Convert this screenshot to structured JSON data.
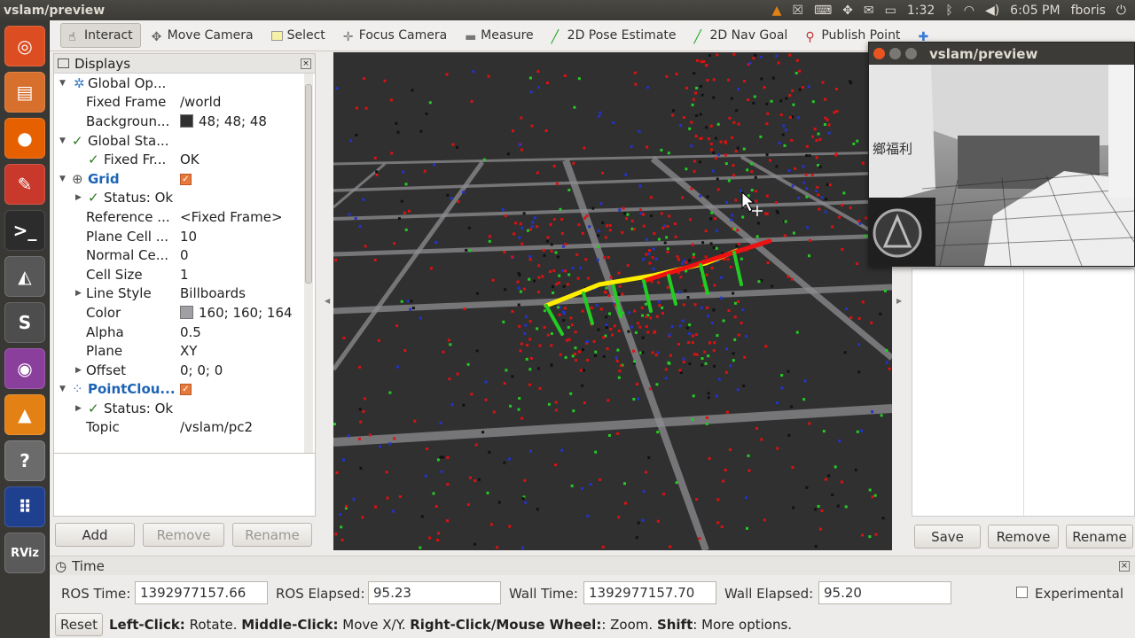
{
  "window": {
    "title": "vslam/preview"
  },
  "system_tray": {
    "time": "1:32",
    "clock": "6:05 PM",
    "user": "fboris"
  },
  "launcher": {
    "items": [
      {
        "name": "ubuntu-dash-icon",
        "color": "#dc4e21",
        "glyph": "◎"
      },
      {
        "name": "files-icon",
        "color": "#d8702d",
        "glyph": "▤"
      },
      {
        "name": "firefox-icon",
        "color": "#e66000",
        "glyph": "●"
      },
      {
        "name": "system-settings-icon",
        "color": "#c8392b",
        "glyph": "✎"
      },
      {
        "name": "terminal-icon",
        "color": "#2c2c2c",
        "glyph": ">_"
      },
      {
        "name": "inkscape-icon",
        "color": "#575757",
        "glyph": "◭"
      },
      {
        "name": "sublime-text-icon",
        "color": "#4d4d4d",
        "glyph": "S"
      },
      {
        "name": "webcam-icon",
        "color": "#8a3f9c",
        "glyph": "◉"
      },
      {
        "name": "vlc-icon",
        "color": "#e38114",
        "glyph": "▲"
      },
      {
        "name": "help-icon",
        "color": "#6b6b6b",
        "glyph": "?"
      },
      {
        "name": "workspace-switcher-icon",
        "color": "#1f3f8f",
        "glyph": "⠿"
      },
      {
        "name": "rviz-icon",
        "color": "#5a5a5a",
        "glyph": "RViz"
      }
    ]
  },
  "toolbar": {
    "interact": "Interact",
    "move_camera": "Move Camera",
    "select": "Select",
    "focus_camera": "Focus Camera",
    "measure": "Measure",
    "pose_estimate": "2D Pose Estimate",
    "nav_goal": "2D Nav Goal",
    "publish_point": "Publish Point"
  },
  "displays": {
    "title": "Displays",
    "rows": [
      {
        "key": "Global Op...",
        "value": ""
      },
      {
        "key": "Fixed Frame",
        "value": "/world"
      },
      {
        "key": "Backgroun...",
        "value": "48; 48; 48"
      },
      {
        "key": "Global Sta...",
        "value": ""
      },
      {
        "key": "Fixed Fr...",
        "value": "OK"
      },
      {
        "key": "Grid",
        "value": ""
      },
      {
        "key": "Status: Ok",
        "value": ""
      },
      {
        "key": "Reference ...",
        "value": "<Fixed Frame>"
      },
      {
        "key": "Plane Cell ...",
        "value": "10"
      },
      {
        "key": "Normal Ce...",
        "value": "0"
      },
      {
        "key": "Cell Size",
        "value": "1"
      },
      {
        "key": "Line Style",
        "value": "Billboards"
      },
      {
        "key": "Color",
        "value": "160; 160; 164"
      },
      {
        "key": "Alpha",
        "value": "0.5"
      },
      {
        "key": "Plane",
        "value": "XY"
      },
      {
        "key": "Offset",
        "value": "0; 0; 0"
      },
      {
        "key": "PointClou...",
        "value": ""
      },
      {
        "key": "Status: Ok",
        "value": ""
      },
      {
        "key": "Topic",
        "value": "/vslam/pc2"
      }
    ],
    "add": "Add",
    "remove": "Remove",
    "rename": "Rename"
  },
  "right_panel": {
    "save": "Save",
    "remove": "Remove",
    "rename": "Rename"
  },
  "preview": {
    "title": "vslam/preview",
    "sign_text": "鄉福利"
  },
  "time": {
    "title": "Time",
    "ros_time_label": "ROS Time:",
    "ros_time": "1392977157.66",
    "ros_elapsed_label": "ROS Elapsed:",
    "ros_elapsed": "95.23",
    "wall_time_label": "Wall Time:",
    "wall_time": "1392977157.70",
    "wall_elapsed_label": "Wall Elapsed:",
    "wall_elapsed": "95.20",
    "experimental": "Experimental"
  },
  "status": {
    "reset": "Reset",
    "left_click": "Left-Click:",
    "left_click_desc": " Rotate. ",
    "middle_click": "Middle-Click:",
    "middle_click_desc": " Move X/Y. ",
    "right_click": "Right-Click/Mouse Wheel:",
    "right_click_desc": ": Zoom. ",
    "shift": "Shift",
    "shift_desc": ": More options."
  },
  "colors": {
    "background": "#303030",
    "grid": "#a0a0a4",
    "trajectory": "#ffee00",
    "pose_up": "#22cc22",
    "pose_red": "#ee1111"
  }
}
